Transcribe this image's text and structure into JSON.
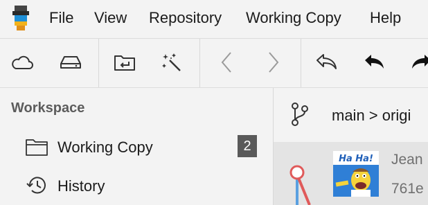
{
  "menu": {
    "file": "File",
    "view": "View",
    "repository": "Repository",
    "working_copy": "Working Copy",
    "help": "Help"
  },
  "toolbar": {
    "icons": [
      "cloud-icon",
      "drive-icon",
      "folder-return-icon",
      "magic-wand-icon",
      "chevron-left-icon",
      "chevron-right-icon",
      "undo-outline-icon",
      "undo-filled-icon",
      "redo-filled-icon"
    ]
  },
  "sidebar": {
    "title": "Workspace",
    "items": [
      {
        "label": "Working Copy",
        "icon": "folder-icon",
        "badge": "2"
      },
      {
        "label": "History",
        "icon": "history-icon"
      }
    ]
  },
  "branch": {
    "icon": "branch-icon",
    "text": "main > origi"
  },
  "commit": {
    "author": "Jean",
    "hash": "761e",
    "avatar_caption": "Ha Ha!"
  },
  "colors": {
    "background": "#f3f3f3",
    "list_background": "#e4e4e4",
    "badge": "#595959",
    "graph_node": "#e05a5a",
    "graph_line": "#5aa0e0"
  }
}
